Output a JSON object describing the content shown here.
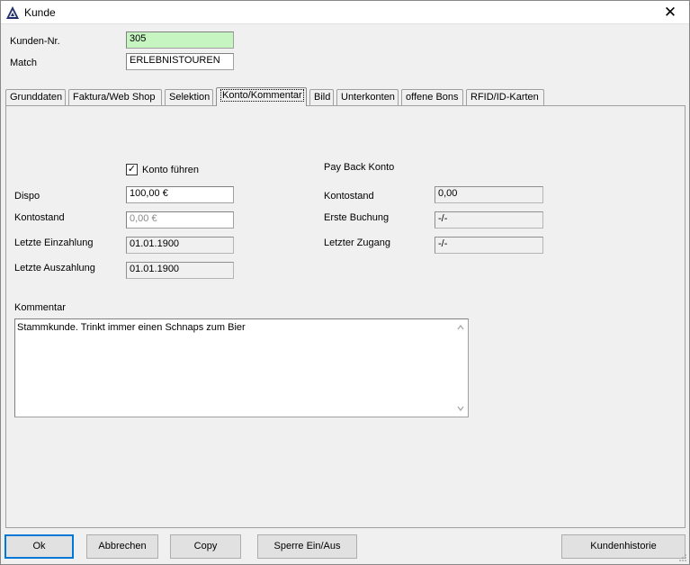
{
  "window": {
    "title": "Kunde",
    "close_symbol": "✕"
  },
  "header": {
    "kunden_nr_label": "Kunden-Nr.",
    "kunden_nr_value": "305",
    "match_label": "Match",
    "match_value": "ERLEBNISTOUREN"
  },
  "tabs": [
    {
      "label": "Grunddaten"
    },
    {
      "label": "Faktura/Web Shop"
    },
    {
      "label": "Selektion"
    },
    {
      "label": "Konto/Kommentar"
    },
    {
      "label": "Bild"
    },
    {
      "label": "Unterkonten"
    },
    {
      "label": "offene Bons"
    },
    {
      "label": "RFID/ID-Karten"
    }
  ],
  "konto": {
    "konto_fuehren_label": "Konto führen",
    "konto_fuehren_checked": true,
    "check_mark": "✓",
    "dispo_label": "Dispo",
    "dispo_value": "100,00 €",
    "kontostand_label": "Kontostand",
    "kontostand_value": "0,00 €",
    "letzte_einzahlung_label": "Letzte Einzahlung",
    "letzte_einzahlung_value": "01.01.1900",
    "letzte_auszahlung_label": "Letzte Auszahlung",
    "letzte_auszahlung_value": "01.01.1900"
  },
  "payback": {
    "section_label": "Pay Back Konto",
    "kontostand_label": "Kontostand",
    "kontostand_value": "0,00",
    "erste_buchung_label": "Erste Buchung",
    "erste_buchung_value": "-/-",
    "letzter_zugang_label": "Letzter Zugang",
    "letzter_zugang_value": "-/-"
  },
  "kommentar": {
    "label": "Kommentar",
    "text": "Stammkunde. Trinkt immer einen Schnaps zum Bier"
  },
  "buttons": {
    "ok": "Ok",
    "abbrechen": "Abbrechen",
    "copy": "Copy",
    "sperre": "Sperre Ein/Aus",
    "kundenhistorie": "Kundenhistorie"
  }
}
